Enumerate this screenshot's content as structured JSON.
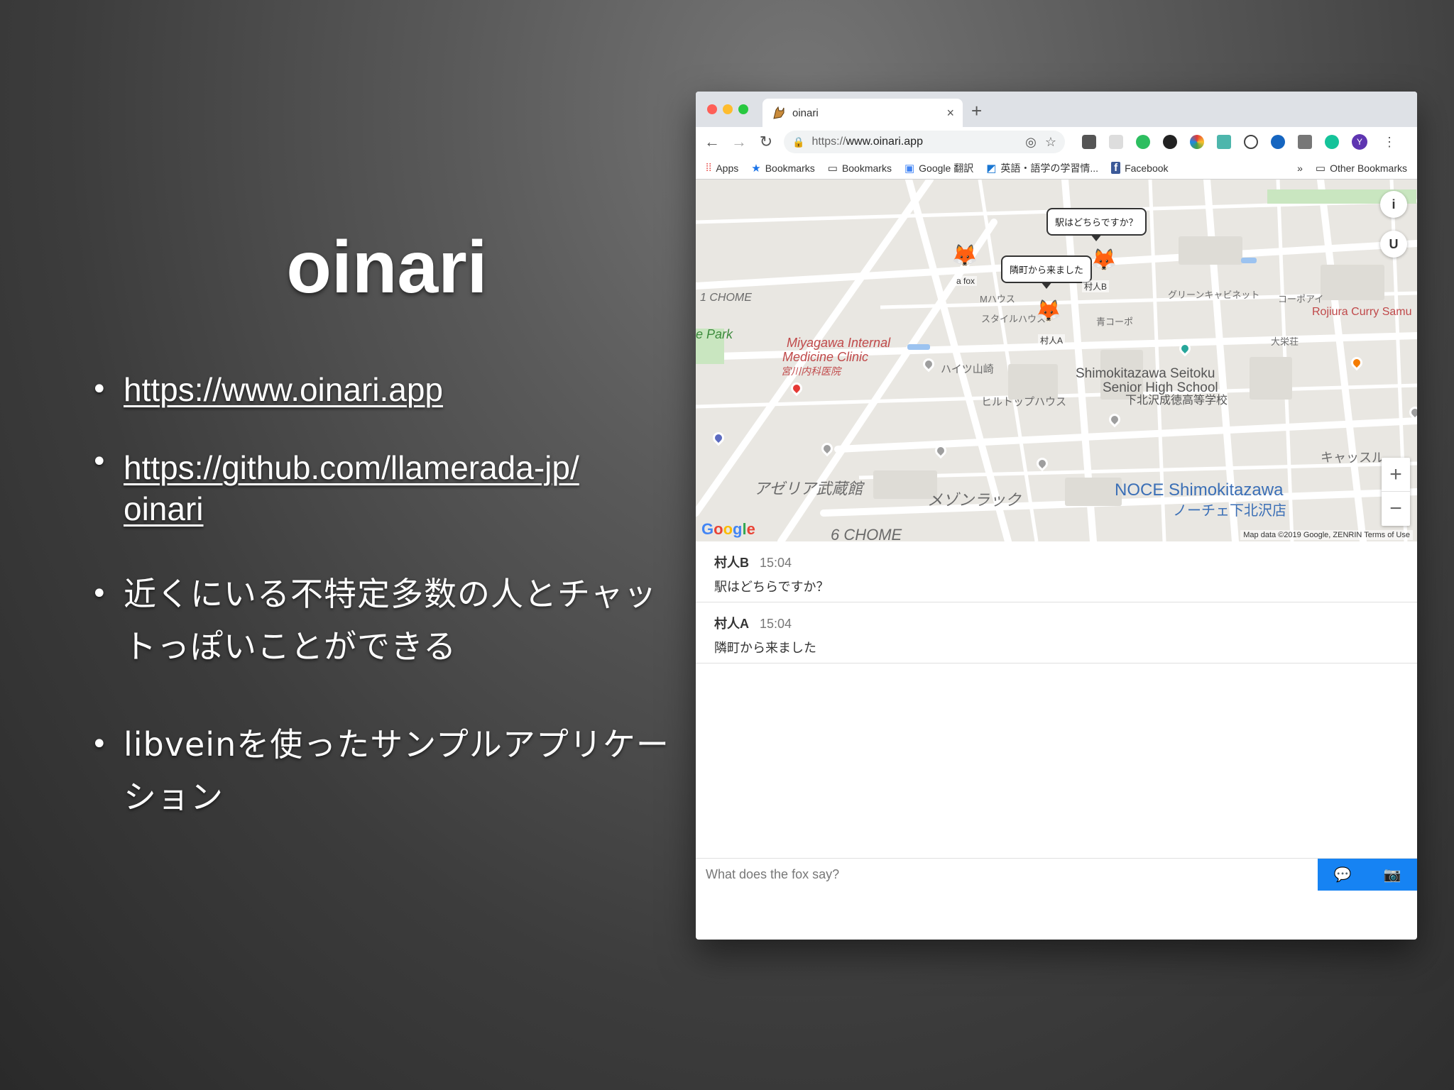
{
  "slide": {
    "title": "oinari",
    "bullets": [
      {
        "text": "https://www.oinari.app",
        "link": true
      },
      {
        "line1": "https://github.com/llamerada-jp/",
        "line2": "oinari",
        "link": true
      },
      {
        "line1": "近くにいる不特定多数の人とチャッ",
        "line2": "トっぽいことができる"
      },
      {
        "line1": "libveinを使ったサンプルアプリケー",
        "line2": "ション"
      }
    ]
  },
  "browser": {
    "tab_title": "oinari",
    "tab_close": "×",
    "new_tab": "+",
    "url_prefix": "https://",
    "url_host": "www.oinari.app",
    "avatar_letter": "Y",
    "bookmarks": [
      "Apps",
      "Bookmarks",
      "Bookmarks",
      "Google 翻訳",
      "英語・語学の学習情...",
      "Facebook"
    ],
    "bookmarks_more": "»",
    "other_bookmarks": "Other Bookmarks"
  },
  "map": {
    "bubble_b": "駅はどちらですか？",
    "bubble_a": "隣町から来ました",
    "fox_self_label": "a fox",
    "fox_a_label": "村人A",
    "fox_b_label": "村人B",
    "labels": {
      "miyagawa1": "Miyagawa Internal",
      "miyagawa2": "Medicine Clinic",
      "miyagawa_jp": "宮川内科医院",
      "school1": "Shimokitazawa Seitoku",
      "school2": "Senior High School",
      "school_jp": "下北沢成徳高等学校",
      "noce": "NOCE Shimokitazawa",
      "noce_jp": "ノーチェ下北沢店",
      "azeria": "アゼリア武蔵館",
      "mezon": "メゾンラック",
      "hilltop": "ヒルトップハウス",
      "haitsu": "ハイツ山崎",
      "chome6": "6 CHOME",
      "chome1": "1 CHOME",
      "park": "e Park",
      "rojiura": "Rojiura Curry Samu",
      "cash": "キャッスル",
      "mhouse": "Mハウス",
      "aoko": "青コーポ",
      "style": "スタイルハウス",
      "green": "グリーンキャビネット",
      "corp": "コーポアイ",
      "daiei": "大栄荘"
    },
    "zoom_in": "+",
    "zoom_out": "−",
    "google": [
      "G",
      "o",
      "o",
      "g",
      "l",
      "e"
    ],
    "attribution": "Map data ©2019 Google, ZENRIN   Terms of Use"
  },
  "chat": {
    "messages": [
      {
        "name": "村人B",
        "time": "15:04",
        "text": "駅はどちらですか？"
      },
      {
        "name": "村人A",
        "time": "15:04",
        "text": "隣町から来ました"
      }
    ],
    "placeholder": "What does the fox say?"
  }
}
